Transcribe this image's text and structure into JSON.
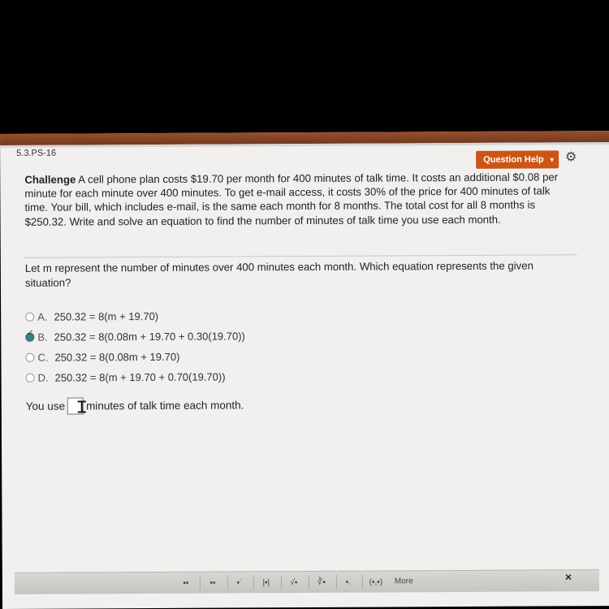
{
  "header": {
    "question_id": "5.3.PS-16",
    "help_button": "Question Help",
    "help_caret": "▼",
    "settings_icon": "gear-icon"
  },
  "problem": {
    "label": "Challenge",
    "text": "A cell phone plan costs $19.70 per month for 400 minutes of talk time. It costs an additional $0.08 per minute for each minute over 400 minutes. To get e-mail access, it costs 30% of the price for 400 minutes of talk time. Your bill, which includes e-mail, is the same each month for 8 months. The total cost for all 8 months is $250.32. Write and solve an equation to find the number of minutes of talk time you use each month."
  },
  "question": {
    "text": "Let m represent the number of minutes over 400 minutes each month. Which equation represents the given situation?"
  },
  "options": [
    {
      "letter": "A.",
      "equation": "250.32 = 8(m + 19.70)",
      "selected": false
    },
    {
      "letter": "B.",
      "equation": "250.32 = 8(0.08m + 19.70 + 0.30(19.70))",
      "selected": true
    },
    {
      "letter": "C.",
      "equation": "250.32 = 8(0.08m + 19.70)",
      "selected": false
    },
    {
      "letter": "D.",
      "equation": "250.32 = 8(m + 19.70 + 0.70(19.70))",
      "selected": false
    }
  ],
  "answer": {
    "prefix": "You use",
    "suffix": "minutes of talk time each month.",
    "value": ""
  },
  "toolbar": {
    "items": [
      "▪▪",
      "▪▪",
      "▪˙",
      "|▪|",
      "√▪",
      "∛▪",
      "▪.",
      "(▪,▪)"
    ],
    "more": "More",
    "close": "×"
  }
}
